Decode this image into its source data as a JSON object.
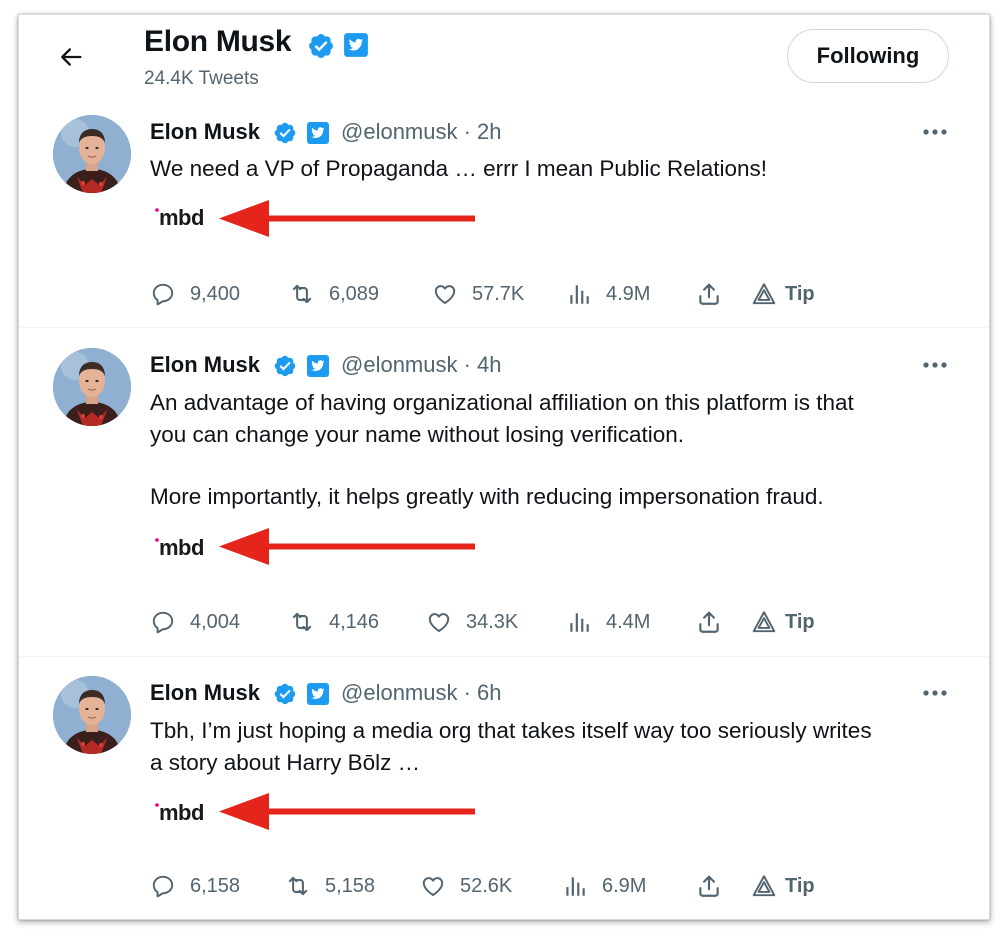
{
  "header": {
    "name": "Elon Musk",
    "tweet_count": "24.4K Tweets",
    "follow_label": "Following"
  },
  "colors": {
    "verified_blue": "#1d9bf0",
    "arrow_red": "#e5251b",
    "mbd_pink": "#e6007e"
  },
  "tweets": [
    {
      "name": "Elon Musk",
      "handle": "@elonmusk · 2h",
      "lines": [
        "We need a VP of Propaganda … errr I mean Public Relations!"
      ],
      "brand": "mbd",
      "replies": "9,400",
      "retweets": "6,089",
      "likes": "57.7K",
      "views": "4.9M",
      "tip": "Tip"
    },
    {
      "name": "Elon Musk",
      "handle": "@elonmusk · 4h",
      "lines": [
        "An advantage of having organizational affiliation on this platform is that",
        "you can change your name without losing verification.",
        "More importantly, it helps greatly with reducing impersonation fraud."
      ],
      "brand": "mbd",
      "replies": "4,004",
      "retweets": "4,146",
      "likes": "34.3K",
      "views": "4.4M",
      "tip": "Tip"
    },
    {
      "name": "Elon Musk",
      "handle": "@elonmusk · 6h",
      "lines": [
        "Tbh, I’m just hoping a media org that takes itself way too seriously writes",
        "a story about Harry Bōlz …"
      ],
      "brand": "mbd",
      "replies": "6,158",
      "retweets": "5,158",
      "likes": "52.6K",
      "views": "6.9M",
      "tip": "Tip"
    }
  ]
}
